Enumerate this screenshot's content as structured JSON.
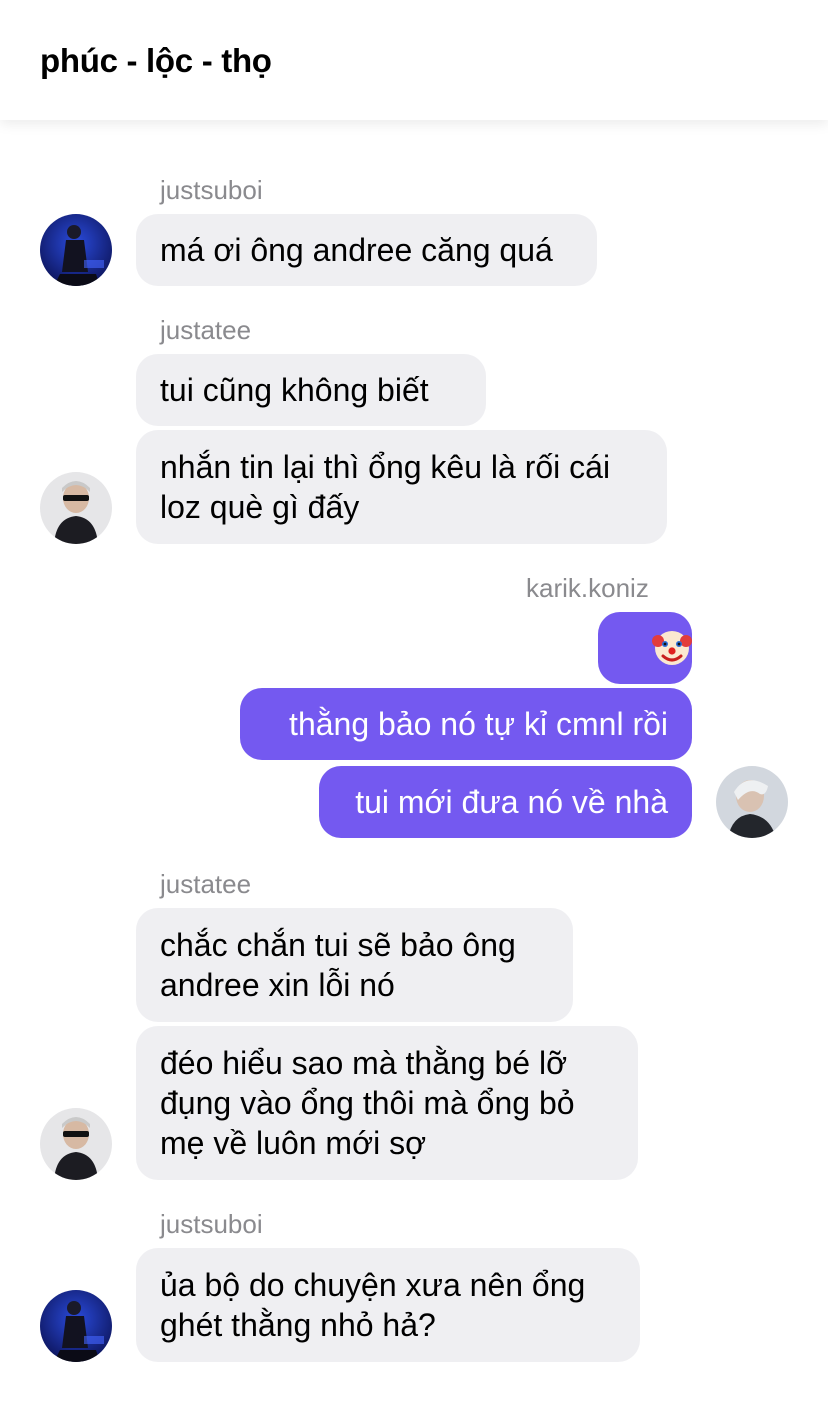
{
  "header": {
    "title": "phúc - lộc - thọ"
  },
  "conversation": {
    "group1": {
      "sender": "justsuboi",
      "messages": [
        "má ơi ông andree căng quá"
      ]
    },
    "group2": {
      "sender": "justatee",
      "messages": [
        "tui cũng không biết",
        "nhắn tin lại thì ổng kêu là rối cái",
        "loz què gì đấy"
      ]
    },
    "group3": {
      "sender": "karik.koniz",
      "messages": [
        "🤡",
        "thằng bảo nó tự kỉ cmnl rồi",
        "tui mới đưa nó về nhà"
      ]
    },
    "group4": {
      "sender": "justatee",
      "messages": [
        "chắc chắn tui sẽ bảo ông",
        "andree xin lỗi nó",
        "đéo hiểu sao mà thằng bé lỡ",
        "đụng vào ổng thôi mà ổng bỏ",
        "mẹ về luôn mới sợ"
      ]
    },
    "group5": {
      "sender": "justsuboi",
      "messages": [
        "ủa bộ do chuyện xưa nên ổng",
        "ghét thằng nhỏ hả?"
      ]
    }
  },
  "colors": {
    "outgoing_bubble": "#7459f0",
    "incoming_bubble": "#efeff2",
    "sender_label": "#8a8a8e"
  },
  "icons": {
    "clown": "clown-face-emoji"
  }
}
